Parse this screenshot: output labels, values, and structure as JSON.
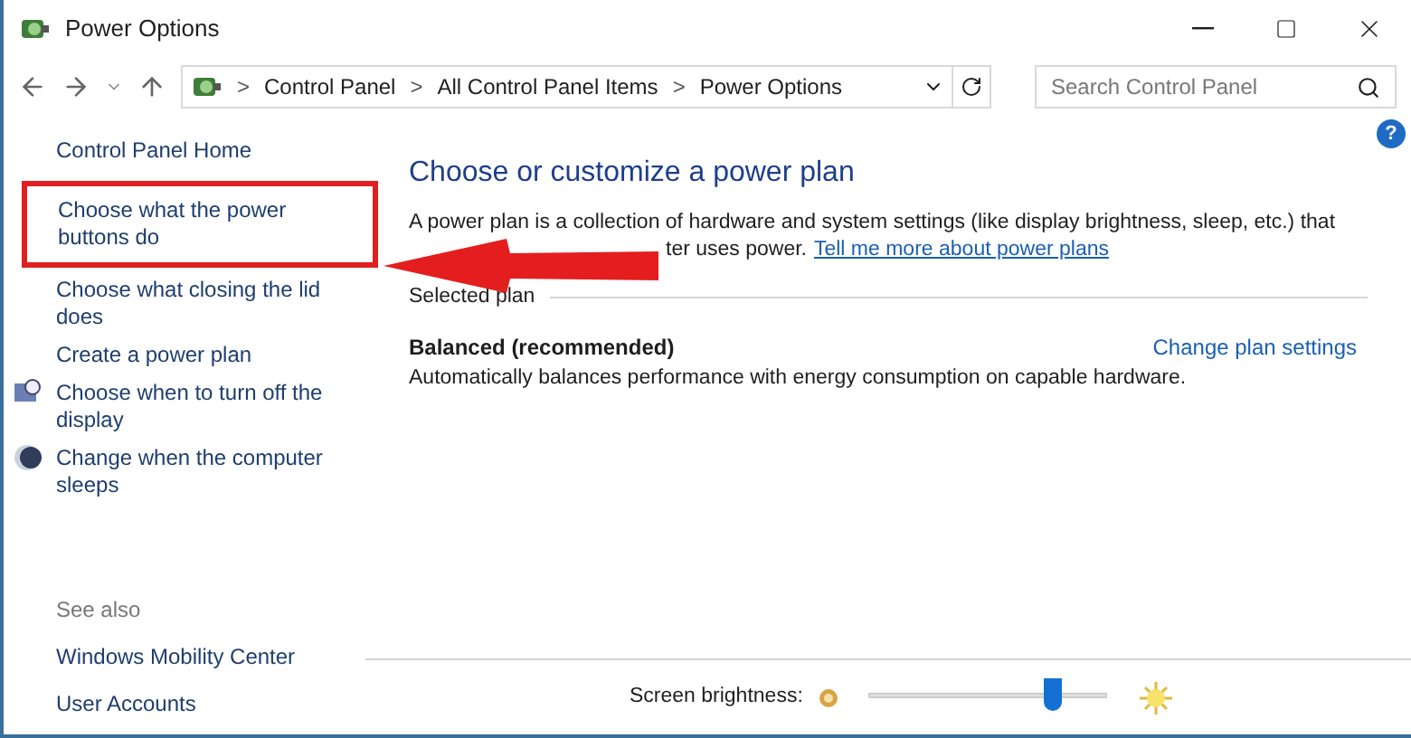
{
  "window": {
    "title": "Power Options"
  },
  "address_bar": {
    "breadcrumbs": [
      "Control Panel",
      "All Control Panel Items",
      "Power Options"
    ],
    "separator": ">"
  },
  "search": {
    "placeholder": "Search Control Panel"
  },
  "sidebar": {
    "home": "Control Panel Home",
    "items": [
      {
        "label": "Choose what the power buttons do",
        "kind": "plain",
        "highlighted": true
      },
      {
        "label": "Choose what closing the lid does",
        "kind": "plain",
        "highlighted": false
      },
      {
        "label": "Create a power plan",
        "kind": "plain",
        "highlighted": false
      },
      {
        "label": "Choose when to turn off the display",
        "kind": "display",
        "highlighted": false
      },
      {
        "label": "Change when the computer sleeps",
        "kind": "sleep",
        "highlighted": false
      }
    ],
    "see_also": {
      "heading": "See also",
      "links": [
        "Windows Mobility Center",
        "User Accounts"
      ]
    }
  },
  "main": {
    "help": "?",
    "heading": "Choose or customize a power plan",
    "description_line_1": "A power plan is a collection of hardware and system settings (like display brightness, sleep, etc.) that",
    "description_line_2": "ter uses power.",
    "description_link": "Tell me more about power plans",
    "section": "Selected plan",
    "plan": {
      "name": "Balanced (recommended)",
      "description": "Automatically balances performance with energy consumption on capable hardware.",
      "settings_link": "Change plan settings"
    }
  },
  "brightness": {
    "label": "Screen brightness:",
    "level": 0.77
  }
}
